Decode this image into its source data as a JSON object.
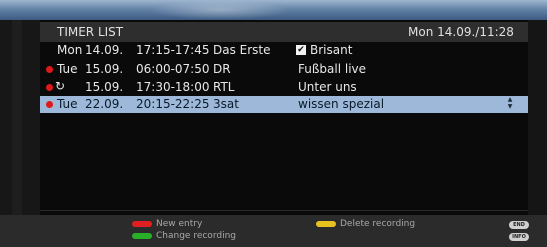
{
  "header": {
    "title": "TIMER LIST",
    "clock": "Mon 14.09./11:28"
  },
  "rows": [
    {
      "day": "Mon",
      "date": "14.09.",
      "time": "17:15-17:45",
      "channel": "Das Erste",
      "title": "Brisant",
      "recording": false,
      "repeat": false,
      "checked": true,
      "selected": false
    },
    {
      "day": "Tue",
      "date": "15.09.",
      "time": "06:00-07:50",
      "channel": "DR",
      "title": "Fußball live",
      "recording": true,
      "repeat": false,
      "checked": false,
      "selected": false
    },
    {
      "day": "",
      "date": "15.09.",
      "time": "17:30-18:00",
      "channel": "RTL",
      "title": "Unter uns",
      "recording": true,
      "repeat": true,
      "checked": false,
      "selected": false
    },
    {
      "day": "Tue",
      "date": "22.09.",
      "time": "20:15-22:25",
      "channel": "3sat",
      "title": "wissen spezial",
      "recording": true,
      "repeat": false,
      "checked": false,
      "selected": true
    }
  ],
  "footer": {
    "new_entry": "New entry",
    "change_recording": "Change recording",
    "delete_recording": "Delete recording",
    "end_key": "END",
    "info_key": "INFO"
  },
  "colors": {
    "red_key": "#e02020",
    "green_key": "#28b028",
    "yellow_key": "#e6c21e",
    "selection": "#9db8d8",
    "recording_dot": "#e01818"
  },
  "icons": {
    "recording": "red-dot-icon",
    "repeat": "repeat-icon",
    "checked": "checkbox-checked-icon"
  }
}
